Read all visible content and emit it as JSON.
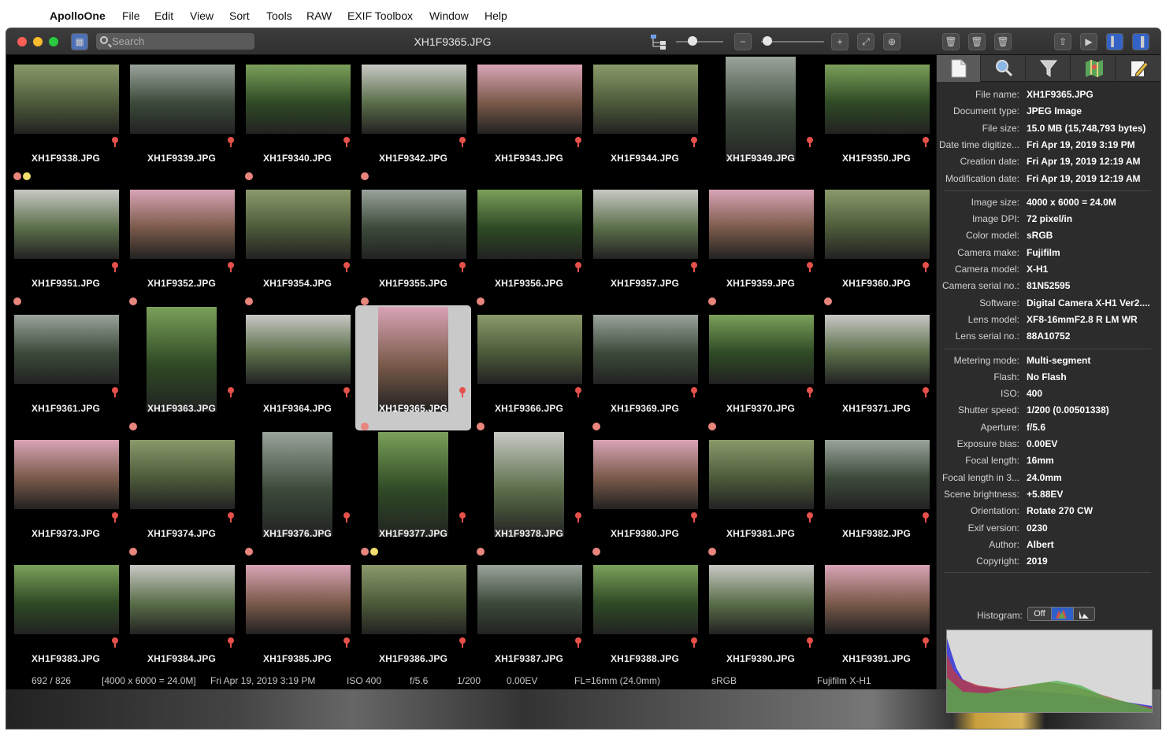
{
  "menubar": {
    "apple_glyph": "",
    "items": [
      {
        "label": "ApolloOne"
      },
      {
        "label": "File"
      },
      {
        "label": "Edit"
      },
      {
        "label": "View"
      },
      {
        "label": "Sort"
      },
      {
        "label": "Tools"
      },
      {
        "label": "RAW"
      },
      {
        "label": "EXIF Toolbox"
      },
      {
        "label": "Window"
      },
      {
        "label": "Help"
      }
    ]
  },
  "window": {
    "title": "XH1F9365.JPG",
    "search_placeholder": "Search",
    "zoom_level": 0.35,
    "thumb_size_level": 0.1
  },
  "grid": {
    "cells": [
      {
        "name": "XH1F9338.JPG",
        "orient": "l",
        "pin": true
      },
      {
        "name": "XH1F9339.JPG",
        "orient": "l",
        "pin": true
      },
      {
        "name": "XH1F9340.JPG",
        "orient": "l",
        "pin": true
      },
      {
        "name": "XH1F9342.JPG",
        "orient": "l",
        "pin": true
      },
      {
        "name": "XH1F9343.JPG",
        "orient": "l",
        "pin": true
      },
      {
        "name": "XH1F9344.JPG",
        "orient": "l",
        "pin": true
      },
      {
        "name": "XH1F9349.JPG",
        "orient": "p",
        "pin": true
      },
      {
        "name": "XH1F9350.JPG",
        "orient": "l",
        "pin": true
      },
      {
        "name": "XH1F9351.JPG",
        "orient": "l",
        "pin": true
      },
      {
        "name": "XH1F9352.JPG",
        "orient": "l",
        "pin": true
      },
      {
        "name": "XH1F9354.JPG",
        "orient": "l",
        "pin": true
      },
      {
        "name": "XH1F9355.JPG",
        "orient": "l",
        "pin": true
      },
      {
        "name": "XH1F9356.JPG",
        "orient": "l",
        "pin": true
      },
      {
        "name": "XH1F9357.JPG",
        "orient": "l",
        "pin": true
      },
      {
        "name": "XH1F9359.JPG",
        "orient": "l",
        "pin": true
      },
      {
        "name": "XH1F9360.JPG",
        "orient": "l",
        "pin": true
      },
      {
        "name": "XH1F9361.JPG",
        "orient": "l",
        "pin": true
      },
      {
        "name": "XH1F9363.JPG",
        "orient": "p",
        "pin": true
      },
      {
        "name": "XH1F9364.JPG",
        "orient": "l",
        "pin": true
      },
      {
        "name": "XH1F9365.JPG",
        "orient": "p",
        "pin": true,
        "selected": true
      },
      {
        "name": "XH1F9366.JPG",
        "orient": "l",
        "pin": true
      },
      {
        "name": "XH1F9369.JPG",
        "orient": "l",
        "pin": true
      },
      {
        "name": "XH1F9370.JPG",
        "orient": "l",
        "pin": true
      },
      {
        "name": "XH1F9371.JPG",
        "orient": "l",
        "pin": true
      },
      {
        "name": "XH1F9373.JPG",
        "orient": "l",
        "pin": true
      },
      {
        "name": "XH1F9374.JPG",
        "orient": "l",
        "pin": true
      },
      {
        "name": "XH1F9376.JPG",
        "orient": "p",
        "pin": true
      },
      {
        "name": "XH1F9377.JPG",
        "orient": "p",
        "pin": true
      },
      {
        "name": "XH1F9378.JPG",
        "orient": "p",
        "pin": true
      },
      {
        "name": "XH1F9380.JPG",
        "orient": "l",
        "pin": true
      },
      {
        "name": "XH1F9381.JPG",
        "orient": "l",
        "pin": true
      },
      {
        "name": "XH1F9382.JPG",
        "orient": "l",
        "pin": true
      },
      {
        "name": "XH1F9383.JPG",
        "orient": "l",
        "pin": true
      },
      {
        "name": "XH1F9384.JPG",
        "orient": "l",
        "pin": true
      },
      {
        "name": "XH1F9385.JPG",
        "orient": "l",
        "pin": true
      },
      {
        "name": "XH1F9386.JPG",
        "orient": "l",
        "pin": true
      },
      {
        "name": "XH1F9387.JPG",
        "orient": "l",
        "pin": true
      },
      {
        "name": "XH1F9388.JPG",
        "orient": "l",
        "pin": true
      },
      {
        "name": "XH1F9390.JPG",
        "orient": "l",
        "pin": true
      },
      {
        "name": "XH1F9391.JPG",
        "orient": "l",
        "pin": true
      }
    ]
  },
  "status": {
    "position": "692 / 826",
    "dims": "[4000 x 6000 = 24.0M]",
    "date": "Fri Apr 19, 2019  3:19 PM",
    "iso": "ISO 400",
    "aperture": "f/5.6",
    "shutter": "1/200",
    "ev": "0.00EV",
    "focal": "FL=16mm (24.0mm)",
    "color": "sRGB",
    "camera": "Fujifilm X-H1"
  },
  "inspector": {
    "tabs": [
      "info-tab",
      "search-tab",
      "filter-tab",
      "map-tab",
      "edit-tab"
    ],
    "rows": [
      {
        "k": "File name:",
        "v": "XH1F9365.JPG"
      },
      {
        "k": "Document type:",
        "v": "JPEG Image"
      },
      {
        "k": "File size:",
        "v": "15.0 MB (15,748,793 bytes)"
      },
      {
        "k": "Date time digitize...",
        "v": "Fri Apr 19, 2019  3:19 PM"
      },
      {
        "k": "Creation date:",
        "v": "Fri Apr 19, 2019  12:19 AM"
      },
      {
        "k": "Modification date:",
        "v": "Fri Apr 19, 2019  12:19 AM"
      },
      {
        "k": "Image size:",
        "v": "4000 x 6000 = 24.0M"
      },
      {
        "k": "Image DPI:",
        "v": "72 pixel/in"
      },
      {
        "k": "Color model:",
        "v": "sRGB"
      },
      {
        "k": "Camera make:",
        "v": "Fujifilm"
      },
      {
        "k": "Camera model:",
        "v": "X-H1"
      },
      {
        "k": "Camera serial no.:",
        "v": "81N52595"
      },
      {
        "k": "Software:",
        "v": "Digital Camera X-H1 Ver2...."
      },
      {
        "k": "Lens model:",
        "v": "XF8-16mmF2.8 R LM WR"
      },
      {
        "k": "Lens serial no.:",
        "v": "88A10752"
      },
      {
        "k": "Metering mode:",
        "v": "Multi-segment"
      },
      {
        "k": "Flash:",
        "v": "No Flash"
      },
      {
        "k": "ISO:",
        "v": "400"
      },
      {
        "k": "Shutter speed:",
        "v": "1/200 (0.00501338)"
      },
      {
        "k": "Aperture:",
        "v": "f/5.6"
      },
      {
        "k": "Exposure bias:",
        "v": "0.00EV"
      },
      {
        "k": "Focal length:",
        "v": "16mm"
      },
      {
        "k": "Focal length in 3...",
        "v": "24.0mm"
      },
      {
        "k": "Scene brightness:",
        "v": "+5.88EV"
      },
      {
        "k": "Orientation:",
        "v": "Rotate 270 CW"
      },
      {
        "k": "Exif version:",
        "v": "0230"
      },
      {
        "k": "Author:",
        "v": "Albert"
      },
      {
        "k": "Copyright:",
        "v": "2019"
      }
    ],
    "histogram_label": "Histogram:",
    "histogram_off": "Off"
  },
  "colors": {
    "pin": "#e5504a",
    "label_yellow": "#f0dd6e",
    "label_red": "#e8857d",
    "selection": "#c9c9c9"
  }
}
